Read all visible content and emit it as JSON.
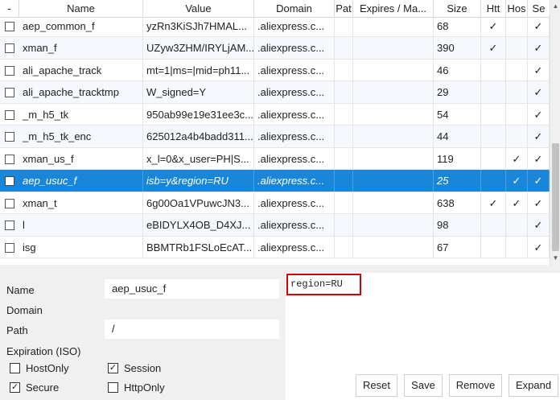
{
  "columns": [
    "-",
    "Name",
    "Value",
    "Domain",
    "Pat",
    "Expires / Ma...",
    "Size",
    "Htt",
    "Hos",
    "Se"
  ],
  "rows": [
    {
      "name": "aep_common_f",
      "value": "yzRn3KiSJh7HMAL...",
      "domain": ".aliexpress.c...",
      "size": "68",
      "http": "✓",
      "host": "",
      "secure": "✓"
    },
    {
      "name": "xman_f",
      "value": "UZyw3ZHM/IRYLjAM...",
      "domain": ".aliexpress.c...",
      "size": "390",
      "http": "✓",
      "host": "",
      "secure": "✓"
    },
    {
      "name": "ali_apache_track",
      "value": "mt=1|ms=|mid=ph11...",
      "domain": ".aliexpress.c...",
      "size": "46",
      "http": "",
      "host": "",
      "secure": "✓"
    },
    {
      "name": "ali_apache_tracktmp",
      "value": "W_signed=Y",
      "domain": ".aliexpress.c...",
      "size": "29",
      "http": "",
      "host": "",
      "secure": "✓"
    },
    {
      "name": "_m_h5_tk",
      "value": "950ab99e19e31ee3c...",
      "domain": ".aliexpress.c...",
      "size": "54",
      "http": "",
      "host": "",
      "secure": "✓"
    },
    {
      "name": "_m_h5_tk_enc",
      "value": "625012a4b4badd311...",
      "domain": ".aliexpress.c...",
      "size": "44",
      "http": "",
      "host": "",
      "secure": "✓"
    },
    {
      "name": "xman_us_f",
      "value": "x_l=0&x_user=PH|S...",
      "domain": ".aliexpress.c...",
      "size": "119",
      "http": "",
      "host": "✓",
      "secure": "✓"
    },
    {
      "name": "aep_usuc_f",
      "value": "isb=y&region=RU",
      "domain": ".aliexpress.c...",
      "size": "25",
      "http": "",
      "host": "✓",
      "secure": "✓",
      "selected": true
    },
    {
      "name": "xman_t",
      "value": "6g00Oa1VPuwcJN3...",
      "domain": ".aliexpress.c...",
      "size": "638",
      "http": "✓",
      "host": "✓",
      "secure": "✓"
    },
    {
      "name": "l",
      "value": "eBIDYLX4OB_D4XJ...",
      "domain": ".aliexpress.c...",
      "size": "98",
      "http": "",
      "host": "",
      "secure": "✓"
    },
    {
      "name": "isg",
      "value": "BBMTRb1FSLoEcAT...",
      "domain": ".aliexpress.c...",
      "size": "67",
      "http": "",
      "host": "",
      "secure": "✓"
    }
  ],
  "editor": {
    "name_label": "Name",
    "name_value": "aep_usuc_f",
    "domain_label": "Domain",
    "path_label": "Path",
    "path_value": "/",
    "expiration_label": "Expiration (ISO)",
    "hostonly_label": "HostOnly",
    "hostonly_checked": false,
    "session_label": "Session",
    "session_checked": true,
    "secure_label": "Secure",
    "secure_checked": true,
    "httponly_label": "HttpOnly",
    "httponly_checked": false,
    "value_text": "region=RU"
  },
  "buttons": {
    "reset": "Reset",
    "save": "Save",
    "remove": "Remove",
    "expand": "Expand"
  },
  "colors": {
    "selection": "#1a86d9",
    "highlight_border": "#d60000"
  },
  "icons": {
    "check": "✓",
    "scroll_up": "▲",
    "scroll_down": "▼"
  }
}
